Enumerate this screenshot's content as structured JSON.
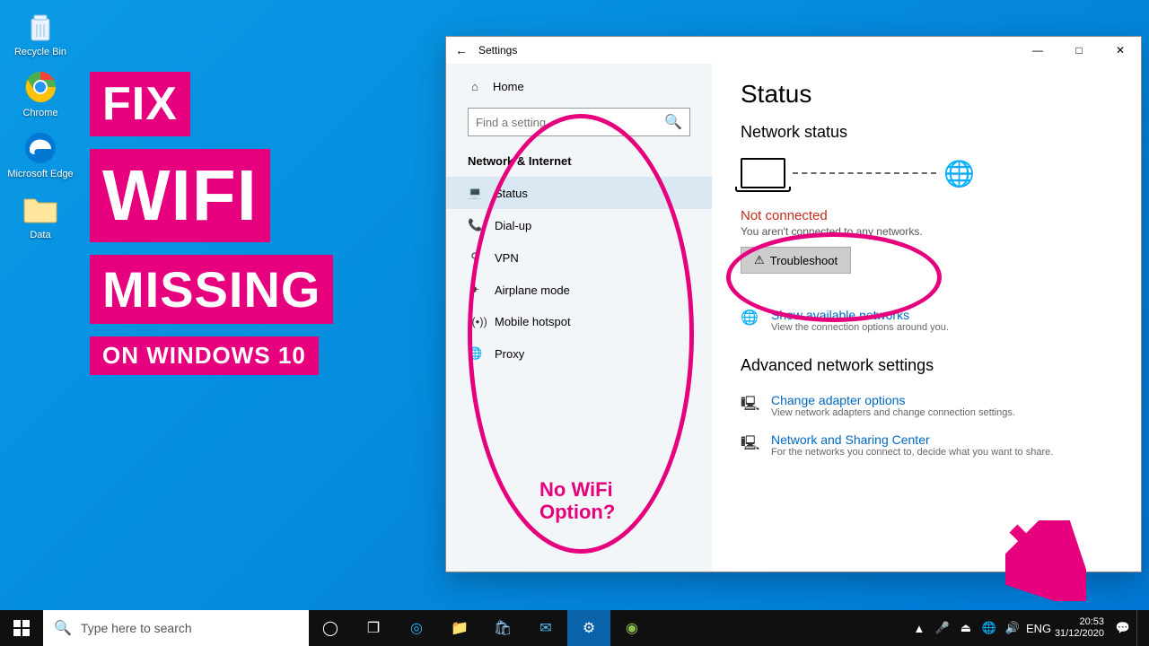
{
  "desktop_icons": {
    "recycle": "Recycle Bin",
    "chrome": "Chrome",
    "edge": "Microsoft Edge",
    "data": "Data"
  },
  "overlay": {
    "fix": "FIX",
    "wifi": "WIFI",
    "missing": "MISSING",
    "onwin": "ON WINDOWS 10"
  },
  "settings": {
    "title": "Settings",
    "home": "Home",
    "search_placeholder": "Find a setting",
    "category": "Network & Internet",
    "nav": {
      "status": "Status",
      "dialup": "Dial-up",
      "vpn": "VPN",
      "airplane": "Airplane mode",
      "hotspot": "Mobile hotspot",
      "proxy": "Proxy"
    },
    "annotation": "No WiFi\nOption?",
    "page": {
      "h1": "Status",
      "h2": "Network status",
      "notconn": "Not connected",
      "notconn_sub": "You aren't connected to any networks.",
      "troubleshoot": "Troubleshoot",
      "show_head": "Show available networks",
      "show_sub": "View the connection options around you.",
      "adv": "Advanced network settings",
      "adapter_head": "Change adapter options",
      "adapter_sub": "View network adapters and change connection settings.",
      "sharing_head": "Network and Sharing Center",
      "sharing_sub": "For the networks you connect to, decide what you want to share."
    }
  },
  "taskbar": {
    "search_placeholder": "Type here to search",
    "lang": "ENG",
    "time": "20:53",
    "date": "31/12/2020"
  }
}
